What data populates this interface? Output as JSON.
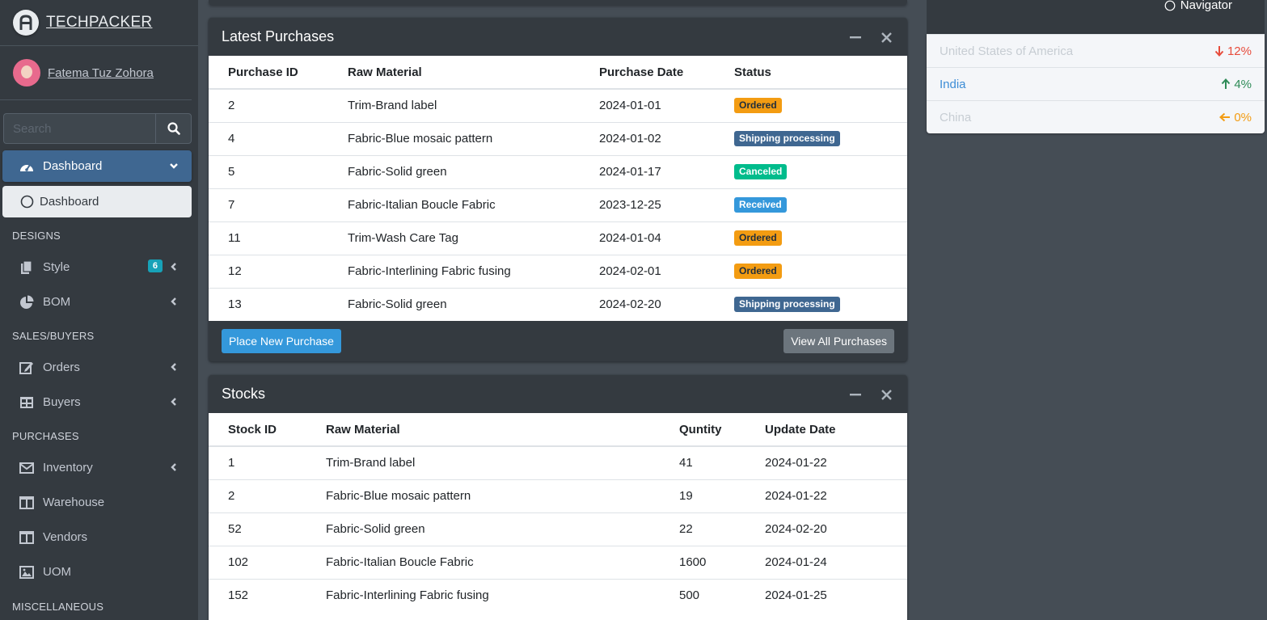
{
  "brand": {
    "name": "TECHPACKER",
    "logo_icon": "brand-logo-icon"
  },
  "user": {
    "name": "Fatema Tuz Zohora"
  },
  "search": {
    "placeholder": "Search"
  },
  "sidebar": {
    "dashboard": {
      "label": "Dashboard",
      "sub_label": "Dashboard"
    },
    "headers": {
      "designs": "DESIGNS",
      "sales": "SALES/BUYERS",
      "purchases": "PURCHASES",
      "misc": "MISCELLANEOUS"
    },
    "items": {
      "style": {
        "label": "Style",
        "badge": "6"
      },
      "bom": {
        "label": "BOM"
      },
      "orders": {
        "label": "Orders"
      },
      "buyers": {
        "label": "Buyers"
      },
      "inventory": {
        "label": "Inventory"
      },
      "warehouse": {
        "label": "Warehouse"
      },
      "vendors": {
        "label": "Vendors"
      },
      "uom": {
        "label": "UOM"
      }
    }
  },
  "purchases": {
    "title": "Latest Purchases",
    "columns": [
      "Purchase ID",
      "Raw Material",
      "Purchase Date",
      "Status"
    ],
    "rows": [
      {
        "id": "2",
        "material": "Trim-Brand label",
        "date": "2024-01-01",
        "status": "Ordered",
        "status_color": "#f39c12",
        "status_text_color": "#1f2d3d"
      },
      {
        "id": "4",
        "material": "Fabric-Blue mosaic pattern",
        "date": "2024-01-02",
        "status": "Shipping processing",
        "status_color": "#3f6791",
        "status_text_color": "#ffffff"
      },
      {
        "id": "5",
        "material": "Fabric-Solid green",
        "date": "2024-01-17",
        "status": "Canceled",
        "status_color": "#00bc8c",
        "status_text_color": "#ffffff"
      },
      {
        "id": "7",
        "material": "Fabric-Italian Boucle Fabric",
        "date": "2023-12-25",
        "status": "Received",
        "status_color": "#3498db",
        "status_text_color": "#ffffff"
      },
      {
        "id": "11",
        "material": "Trim-Wash Care Tag",
        "date": "2024-01-04",
        "status": "Ordered",
        "status_color": "#f39c12",
        "status_text_color": "#1f2d3d"
      },
      {
        "id": "12",
        "material": "Fabric-Interlining Fabric fusing",
        "date": "2024-02-01",
        "status": "Ordered",
        "status_color": "#f39c12",
        "status_text_color": "#1f2d3d"
      },
      {
        "id": "13",
        "material": "Fabric-Solid green",
        "date": "2024-02-20",
        "status": "Shipping processing",
        "status_color": "#3f6791",
        "status_text_color": "#ffffff"
      }
    ],
    "place_button": "Place New Purchase",
    "view_button": "View All Purchases"
  },
  "stocks": {
    "title": "Stocks",
    "columns": [
      "Stock ID",
      "Raw Material",
      "Quntity",
      "Update Date"
    ],
    "rows": [
      {
        "id": "1",
        "material": "Trim-Brand label",
        "qty": "41",
        "date": "2024-01-22"
      },
      {
        "id": "2",
        "material": "Fabric-Blue mosaic pattern",
        "qty": "19",
        "date": "2024-01-22"
      },
      {
        "id": "52",
        "material": "Fabric-Solid green",
        "qty": "22",
        "date": "2024-02-20"
      },
      {
        "id": "102",
        "material": "Fabric-Italian Boucle Fabric",
        "qty": "1600",
        "date": "2024-01-24"
      },
      {
        "id": "152",
        "material": "Fabric-Interlining Fabric fusing",
        "qty": "500",
        "date": "2024-01-25"
      }
    ]
  },
  "navigator": {
    "label": "Navigator"
  },
  "countries": [
    {
      "name": "United States of America",
      "change": "12%",
      "direction": "down",
      "name_color": "#c7cdd3",
      "change_color": "#e74c3c"
    },
    {
      "name": "India",
      "change": "4%",
      "direction": "up",
      "name_color": "#3d8dd6",
      "change_color": "#2e8b57"
    },
    {
      "name": "China",
      "change": "0%",
      "direction": "left",
      "name_color": "#c7cdd3",
      "change_color": "#f39c12"
    }
  ],
  "colors": {
    "primary": "#3f6791",
    "sidebar_bg": "#343a40",
    "info": "#17a2b8",
    "btn_primary": "#3498db",
    "btn_secondary": "#6c757d"
  }
}
